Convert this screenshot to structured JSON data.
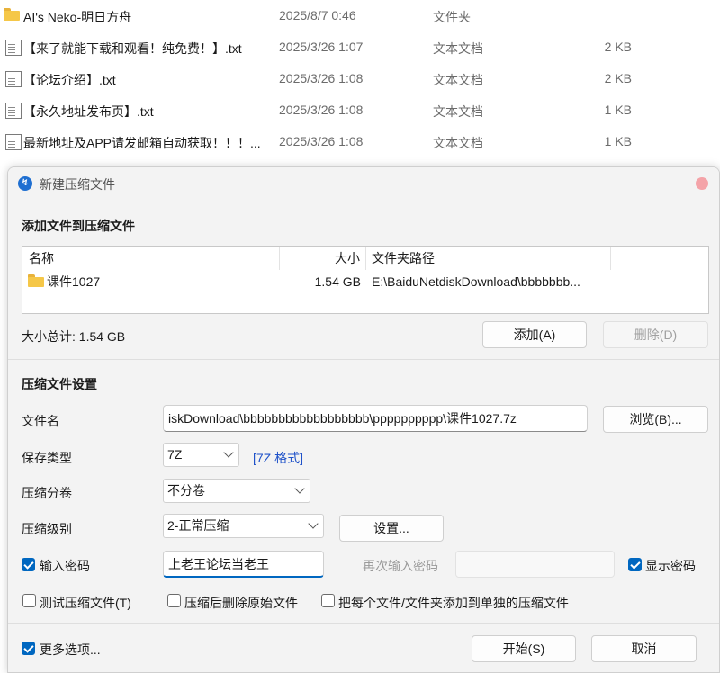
{
  "file_list": {
    "rows": [
      {
        "icon": "folder-icon",
        "name": "AI's Neko-明日方舟",
        "date": "2025/8/7 0:46",
        "type": "文件夹",
        "size": ""
      },
      {
        "icon": "text-file-icon",
        "name": "【来了就能下载和观看！纯免费！】.txt",
        "date": "2025/3/26 1:07",
        "type": "文本文档",
        "size": "2 KB"
      },
      {
        "icon": "text-file-icon",
        "name": "【论坛介绍】.txt",
        "date": "2025/3/26 1:08",
        "type": "文本文档",
        "size": "2 KB"
      },
      {
        "icon": "text-file-icon",
        "name": "【永久地址发布页】.txt",
        "date": "2025/3/26 1:08",
        "type": "文本文档",
        "size": "1 KB"
      },
      {
        "icon": "text-file-icon",
        "name": "最新地址及APP请发邮箱自动获取！！！...",
        "date": "2025/3/26 1:08",
        "type": "文本文档",
        "size": "1 KB"
      }
    ]
  },
  "dialog": {
    "title": "新建压缩文件",
    "add_section": {
      "title": "添加文件到压缩文件",
      "columns": {
        "name": "名称",
        "size": "大小",
        "path": "文件夹路径"
      },
      "items": [
        {
          "name": "课件1027",
          "size": "1.54 GB",
          "path": "E:\\BaiduNetdiskDownload\\bbbbbbb..."
        }
      ],
      "total_size": "大小总计: 1.54 GB",
      "add_button": "添加(A)",
      "delete_button": "删除(D)"
    },
    "settings": {
      "title": "压缩文件设置",
      "filename_label": "文件名",
      "filename_value": "iskDownload\\bbbbbbbbbbbbbbbbbb\\pppppppppp\\课件1027.7z",
      "browse_button": "浏览(B)...",
      "save_type_label": "保存类型",
      "save_type_value": "7Z",
      "save_type_link": "[7Z 格式]",
      "split_label": "压缩分卷",
      "split_value": "不分卷",
      "level_label": "压缩级别",
      "level_value": "2-正常压缩",
      "level_settings_button": "设置...",
      "password_checkbox": "输入密码",
      "password_value": "上老王论坛当老王",
      "reenter_password_label": "再次输入密码",
      "show_password_checkbox": "显示密码",
      "test_checkbox": "测试压缩文件(T)",
      "delete_after_checkbox": "压缩后删除原始文件",
      "separate_checkbox": "把每个文件/文件夹添加到单独的压缩文件"
    },
    "footer": {
      "more_options_checkbox": "更多选项...",
      "start_button": "开始(S)",
      "cancel_button": "取消"
    }
  },
  "colors": {
    "accent": "#0067c0",
    "link": "#1f52c9",
    "folder": "#f5c748",
    "close_dot": "#f4a3a8"
  }
}
